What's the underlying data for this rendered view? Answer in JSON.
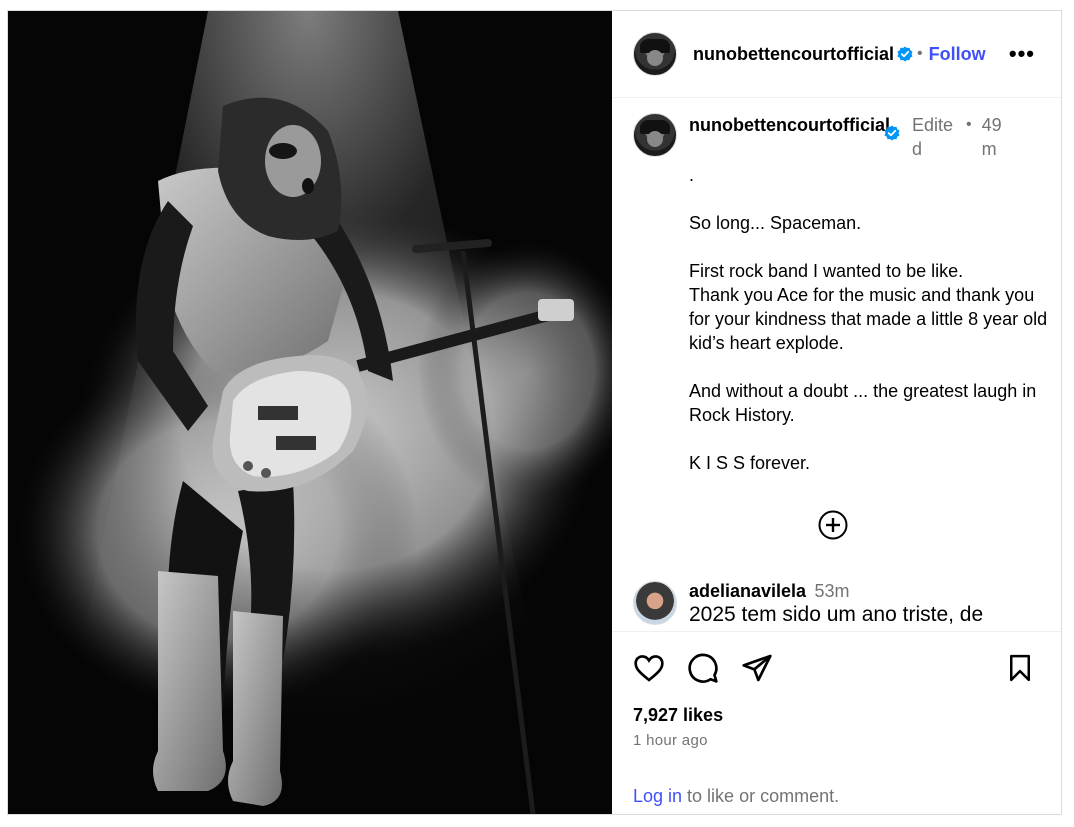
{
  "header": {
    "username": "nunobettencourtofficial",
    "separator": "•",
    "follow_label": "Follow",
    "more_label": "•••"
  },
  "caption": {
    "username": "nunobettencourtofficial",
    "edited": "Edited",
    "separator": "•",
    "time": "49m",
    "text": ".\n\nSo long... Spaceman.\n\nFirst rock band I wanted to be like.\nThank you Ace for the music and thank you for your kindness that made a little 8 year old kid’s heart explode.\n\nAnd without a doubt ... the greatest laugh in Rock History.\n\nK I S S forever."
  },
  "comment": {
    "username": "adelianavilela",
    "time": "53m",
    "text": "2025 tem sido um ano triste, de"
  },
  "actions": {
    "likes": "7,927 likes",
    "time_ago": "1 hour ago",
    "login_link": "Log in",
    "login_rest": " to like or comment."
  },
  "icons": {
    "like": "heart-icon",
    "comment": "comment-icon",
    "share": "send-icon",
    "save": "bookmark-icon",
    "verified": "verified-badge-icon",
    "more_comments": "plus-circle-icon"
  },
  "colors": {
    "link": "#4150f7",
    "verified": "#0095f6",
    "muted": "#737373"
  }
}
